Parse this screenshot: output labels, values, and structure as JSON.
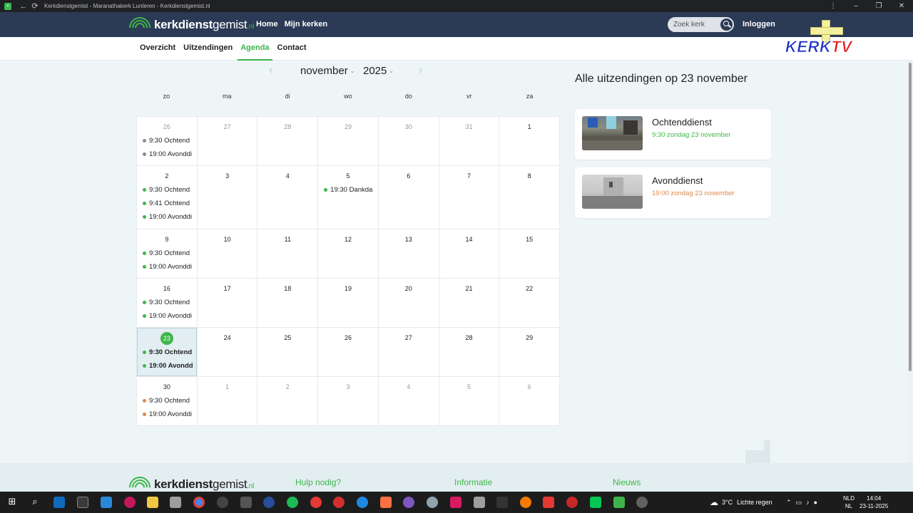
{
  "window": {
    "title": "Kerkdienstgemist - Maranathakerk Lunteren - Kerkdienstgemist.nl"
  },
  "header": {
    "logo_bold": "kerkdienst",
    "logo_light": "gemist",
    "logo_tld": ".nl",
    "nav": [
      "Home",
      "Mijn kerken"
    ],
    "search_placeholder": "Zoek kerk",
    "login": "Inloggen"
  },
  "subnav": {
    "items": [
      "Overzicht",
      "Uitzendingen",
      "Agenda",
      "Contact"
    ],
    "active": "Agenda"
  },
  "overlay_logo": {
    "kerk": "KERK",
    "tv": "TV"
  },
  "calendar": {
    "month": "november",
    "year": "2025",
    "weekdays": [
      "zo",
      "ma",
      "di",
      "wo",
      "do",
      "vr",
      "za"
    ],
    "weeks": [
      [
        {
          "day": "26",
          "dim": true,
          "events": [
            {
              "text": "9:30 Ochtend",
              "color": "#8a8a8a"
            },
            {
              "text": "19:00 Avonddi",
              "color": "#8a8a8a"
            }
          ]
        },
        {
          "day": "27",
          "dim": true,
          "events": []
        },
        {
          "day": "28",
          "dim": true,
          "events": []
        },
        {
          "day": "29",
          "dim": true,
          "events": []
        },
        {
          "day": "30",
          "dim": true,
          "events": []
        },
        {
          "day": "31",
          "dim": true,
          "events": []
        },
        {
          "day": "1",
          "dim": false,
          "events": []
        }
      ],
      [
        {
          "day": "2",
          "dim": false,
          "events": [
            {
              "text": "9:30 Ochtend",
              "color": "#3db54a"
            },
            {
              "text": "9:41 Ochtend",
              "color": "#3db54a"
            },
            {
              "text": "19:00 Avonddi",
              "color": "#3db54a"
            }
          ]
        },
        {
          "day": "3",
          "dim": false,
          "events": []
        },
        {
          "day": "4",
          "dim": false,
          "events": []
        },
        {
          "day": "5",
          "dim": false,
          "events": [
            {
              "text": "19:30 Dankda",
              "color": "#3db54a"
            }
          ]
        },
        {
          "day": "6",
          "dim": false,
          "events": []
        },
        {
          "day": "7",
          "dim": false,
          "events": []
        },
        {
          "day": "8",
          "dim": false,
          "events": []
        }
      ],
      [
        {
          "day": "9",
          "dim": false,
          "events": [
            {
              "text": "9:30 Ochtend",
              "color": "#3db54a"
            },
            {
              "text": "19:00 Avonddi",
              "color": "#3db54a"
            }
          ]
        },
        {
          "day": "10",
          "dim": false,
          "events": []
        },
        {
          "day": "11",
          "dim": false,
          "events": []
        },
        {
          "day": "12",
          "dim": false,
          "events": []
        },
        {
          "day": "13",
          "dim": false,
          "events": []
        },
        {
          "day": "14",
          "dim": false,
          "events": []
        },
        {
          "day": "15",
          "dim": false,
          "events": []
        }
      ],
      [
        {
          "day": "16",
          "dim": false,
          "events": [
            {
              "text": "9:30 Ochtend",
              "color": "#3db54a"
            },
            {
              "text": "19:00 Avonddi",
              "color": "#3db54a"
            }
          ]
        },
        {
          "day": "17",
          "dim": false,
          "events": []
        },
        {
          "day": "18",
          "dim": false,
          "events": []
        },
        {
          "day": "19",
          "dim": false,
          "events": []
        },
        {
          "day": "20",
          "dim": false,
          "events": []
        },
        {
          "day": "21",
          "dim": false,
          "events": []
        },
        {
          "day": "22",
          "dim": false,
          "events": []
        }
      ],
      [
        {
          "day": "23",
          "dim": false,
          "selected": true,
          "events": [
            {
              "text": "9:30 Ochtend",
              "color": "#3db54a"
            },
            {
              "text": "19:00 Avondd",
              "color": "#3db54a"
            }
          ]
        },
        {
          "day": "24",
          "dim": false,
          "events": []
        },
        {
          "day": "25",
          "dim": false,
          "events": []
        },
        {
          "day": "26",
          "dim": false,
          "events": []
        },
        {
          "day": "27",
          "dim": false,
          "events": []
        },
        {
          "day": "28",
          "dim": false,
          "events": []
        },
        {
          "day": "29",
          "dim": false,
          "events": []
        }
      ],
      [
        {
          "day": "30",
          "dim": false,
          "events": [
            {
              "text": "9:30 Ochtend",
              "color": "#e0874a"
            },
            {
              "text": "19:00 Avonddi",
              "color": "#e0874a"
            }
          ]
        },
        {
          "day": "1",
          "dim": true,
          "events": []
        },
        {
          "day": "2",
          "dim": true,
          "events": []
        },
        {
          "day": "3",
          "dim": true,
          "events": []
        },
        {
          "day": "4",
          "dim": true,
          "events": []
        },
        {
          "day": "5",
          "dim": true,
          "events": []
        },
        {
          "day": "6",
          "dim": true,
          "events": []
        }
      ]
    ]
  },
  "broadcasts": {
    "title": "Alle uitzendingen op 23 november",
    "items": [
      {
        "title": "Ochtenddienst",
        "subtitle": "9:30 zondag 23 november",
        "color": "#3db54a"
      },
      {
        "title": "Avonddienst",
        "subtitle": "19:00 zondag 23 november",
        "color": "#e0874a"
      }
    ]
  },
  "footer": {
    "logo_bold": "kerkdienst",
    "logo_light": "gemist",
    "logo_tld": ".nl",
    "headings": [
      "Hulp nodig?",
      "Informatie",
      "Nieuws"
    ]
  },
  "taskbar": {
    "weather_temp": "3°C",
    "weather_text": "Lichte regen",
    "lang_top": "NLD",
    "lang_bottom": "NL",
    "time": "14:04",
    "date": "23-11-2025"
  }
}
